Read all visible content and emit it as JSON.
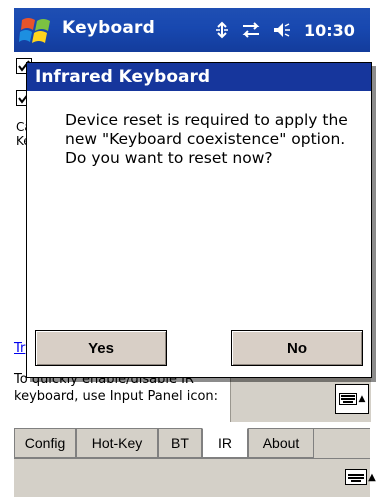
{
  "window": {
    "title": "Keyboard",
    "clock": "10:30"
  },
  "background": {
    "partial_text_1": "Ca",
    "partial_text_2": "Ke",
    "link_partial": "Tr",
    "hint": "To quickly enable/disable IR keyboard, use Input Panel icon:"
  },
  "tabs": [
    {
      "label": "Config",
      "active": false
    },
    {
      "label": "Hot-Key",
      "active": false
    },
    {
      "label": "BT",
      "active": false
    },
    {
      "label": "IR",
      "active": true
    },
    {
      "label": "About",
      "active": false
    }
  ],
  "dialog": {
    "title": "Infrared Keyboard",
    "message": "Device reset is required to apply the new \"Keyboard coexistence\" option. Do you want to reset now?",
    "yes_label": "Yes",
    "no_label": "No"
  },
  "colors": {
    "titlebar": "#1848b0",
    "dialog_title": "#16369c",
    "button_face": "#d8cfc6",
    "panel_gray": "#d4d0c8"
  },
  "icons": {
    "start": "windows-flag-icon",
    "connectivity": "connectivity-icon",
    "signal": "signal-arrows-icon",
    "volume": "speaker-icon",
    "input_panel": "keyboard-icon"
  }
}
